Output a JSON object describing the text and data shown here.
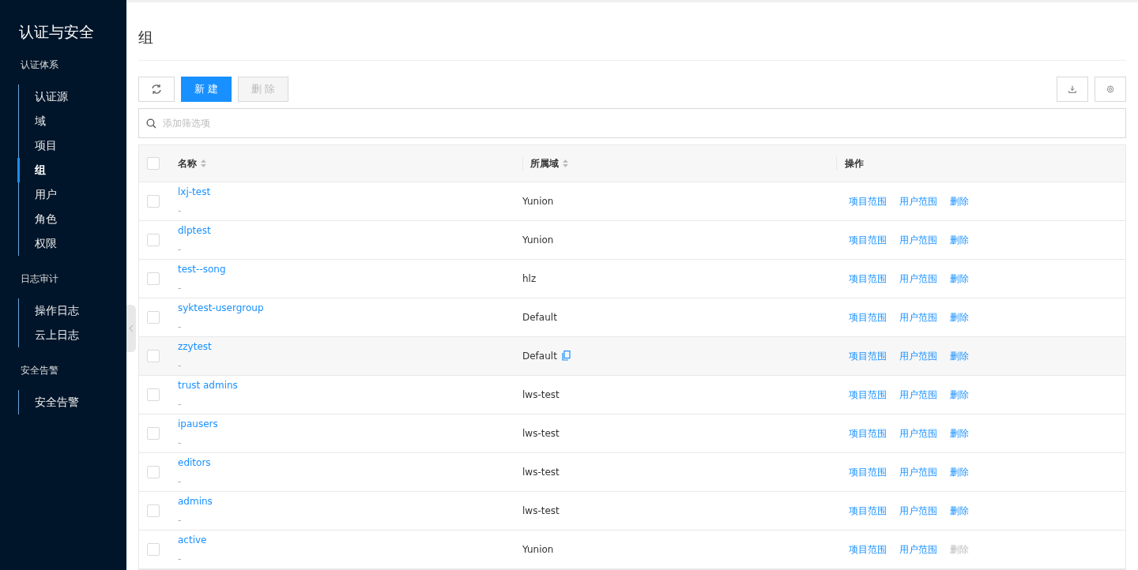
{
  "sidebar": {
    "title": "认证与安全",
    "groups": [
      {
        "label": "认证体系",
        "items": [
          {
            "label": "认证源",
            "selected": false
          },
          {
            "label": "域",
            "selected": false
          },
          {
            "label": "项目",
            "selected": false
          },
          {
            "label": "组",
            "selected": true
          },
          {
            "label": "用户",
            "selected": false
          },
          {
            "label": "角色",
            "selected": false
          },
          {
            "label": "权限",
            "selected": false
          }
        ]
      },
      {
        "label": "日志审计",
        "items": [
          {
            "label": "操作日志",
            "selected": false
          },
          {
            "label": "云上日志",
            "selected": false
          }
        ]
      },
      {
        "label": "安全告警",
        "items": [
          {
            "label": "安全告警",
            "selected": false
          }
        ]
      }
    ]
  },
  "page": {
    "title": "组"
  },
  "toolbar": {
    "create_button": "新 建",
    "delete_button": "删 除",
    "delete_disabled": true
  },
  "search": {
    "placeholder": "添加筛选项"
  },
  "table": {
    "columns": [
      "名称",
      "所属域",
      "操作"
    ],
    "select_all_checked": false,
    "rows": [
      {
        "name": "lxj-test",
        "description": "-",
        "domain": "Yunion",
        "checked": false,
        "highlighted": false,
        "actions": [
          {
            "label": "项目范围",
            "disabled": false
          },
          {
            "label": "用户范围",
            "disabled": false
          },
          {
            "label": "删除",
            "disabled": false
          }
        ]
      },
      {
        "name": "dlptest",
        "description": "-",
        "domain": "Yunion",
        "checked": false,
        "highlighted": false,
        "actions": [
          {
            "label": "项目范围",
            "disabled": false
          },
          {
            "label": "用户范围",
            "disabled": false
          },
          {
            "label": "删除",
            "disabled": false
          }
        ]
      },
      {
        "name": "test--song",
        "description": "-",
        "domain": "hlz",
        "checked": false,
        "highlighted": false,
        "actions": [
          {
            "label": "项目范围",
            "disabled": false
          },
          {
            "label": "用户范围",
            "disabled": false
          },
          {
            "label": "删除",
            "disabled": false
          }
        ]
      },
      {
        "name": "syktest-usergroup",
        "description": "-",
        "domain": "Default",
        "checked": false,
        "highlighted": false,
        "actions": [
          {
            "label": "项目范围",
            "disabled": false
          },
          {
            "label": "用户范围",
            "disabled": false
          },
          {
            "label": "删除",
            "disabled": false
          }
        ]
      },
      {
        "name": "zzytest",
        "description": "-",
        "domain": "Default",
        "checked": false,
        "highlighted": true,
        "actions": [
          {
            "label": "项目范围",
            "disabled": false
          },
          {
            "label": "用户范围",
            "disabled": false
          },
          {
            "label": "删除",
            "disabled": false
          }
        ]
      },
      {
        "name": "trust admins",
        "description": "-",
        "domain": "lws-test",
        "checked": false,
        "highlighted": false,
        "actions": [
          {
            "label": "项目范围",
            "disabled": false
          },
          {
            "label": "用户范围",
            "disabled": false
          },
          {
            "label": "删除",
            "disabled": false
          }
        ]
      },
      {
        "name": "ipausers",
        "description": "-",
        "domain": "lws-test",
        "checked": false,
        "highlighted": false,
        "actions": [
          {
            "label": "项目范围",
            "disabled": false
          },
          {
            "label": "用户范围",
            "disabled": false
          },
          {
            "label": "删除",
            "disabled": false
          }
        ]
      },
      {
        "name": "editors",
        "description": "-",
        "domain": "lws-test",
        "checked": false,
        "highlighted": false,
        "actions": [
          {
            "label": "项目范围",
            "disabled": false
          },
          {
            "label": "用户范围",
            "disabled": false
          },
          {
            "label": "删除",
            "disabled": false
          }
        ]
      },
      {
        "name": "admins",
        "description": "-",
        "domain": "lws-test",
        "checked": false,
        "highlighted": false,
        "actions": [
          {
            "label": "项目范围",
            "disabled": false
          },
          {
            "label": "用户范围",
            "disabled": false
          },
          {
            "label": "删除",
            "disabled": false
          }
        ]
      },
      {
        "name": "active",
        "description": "-",
        "domain": "Yunion",
        "checked": false,
        "highlighted": false,
        "actions": [
          {
            "label": "项目范围",
            "disabled": false
          },
          {
            "label": "用户范围",
            "disabled": false
          },
          {
            "label": "删除",
            "disabled": true
          }
        ]
      }
    ]
  }
}
